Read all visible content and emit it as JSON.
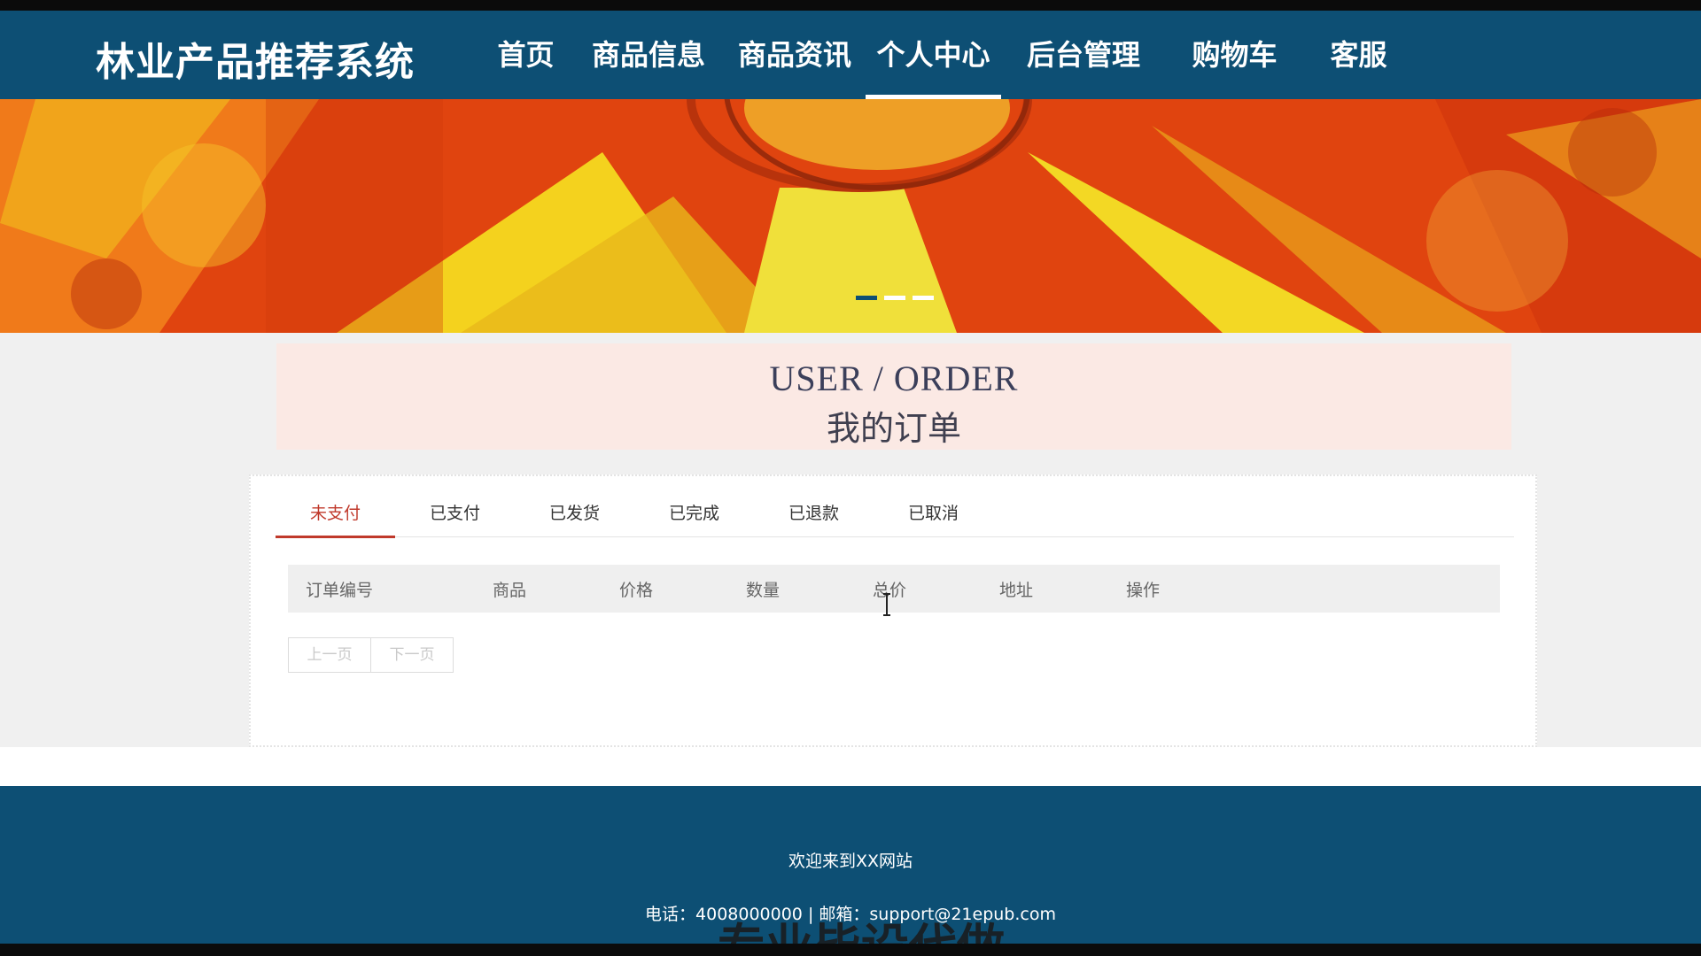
{
  "site": {
    "title": "林业产品推荐系统"
  },
  "nav": {
    "items": [
      {
        "label": "首页",
        "active": false
      },
      {
        "label": "商品信息",
        "active": false
      },
      {
        "label": "商品资讯",
        "active": false
      },
      {
        "label": "个人中心",
        "active": true
      },
      {
        "label": "后台管理",
        "active": false
      },
      {
        "label": "购物车",
        "active": false
      },
      {
        "label": "客服",
        "active": false
      }
    ]
  },
  "banner": {
    "slide_count": 3,
    "active_slide": 1
  },
  "page_title": {
    "en": "USER / ORDER",
    "zh": "我的订单"
  },
  "order_tabs": [
    {
      "label": "未支付",
      "active": true
    },
    {
      "label": "已支付",
      "active": false
    },
    {
      "label": "已发货",
      "active": false
    },
    {
      "label": "已完成",
      "active": false
    },
    {
      "label": "已退款",
      "active": false
    },
    {
      "label": "已取消",
      "active": false
    }
  ],
  "table": {
    "columns": [
      "订单编号",
      "商品",
      "价格",
      "数量",
      "总价",
      "地址",
      "操作"
    ]
  },
  "pager": {
    "prev": "上一页",
    "next": "下一页"
  },
  "footer": {
    "welcome": "欢迎来到XX网站",
    "contact": "电话：4008000000 | 邮箱：support@21epub.com"
  },
  "watermark": {
    "text": "专业毕设代做"
  },
  "colors": {
    "header": "#0d4f74",
    "accent": "#c0392b",
    "title_panel": "#fbe9e4"
  }
}
